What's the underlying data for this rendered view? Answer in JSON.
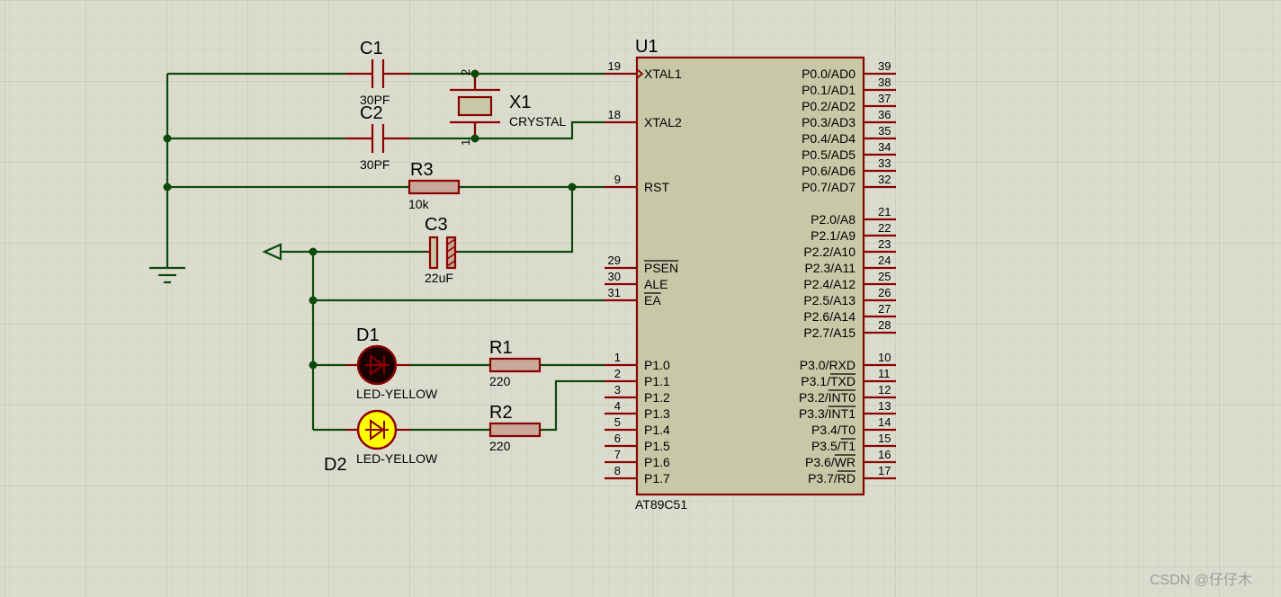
{
  "colors": {
    "background": "#dcdcce",
    "grid_minor": "#cfcfc0",
    "grid_major": "#bfbfae",
    "wire": "#0b4a0b",
    "component_outline": "#8b0000",
    "component_fill": "#c8c8a8",
    "led_d1_fill": "#1a0000",
    "led_d2_fill": "#ffff00"
  },
  "chip": {
    "ref": "U1",
    "part": "AT89C51",
    "left_pins": [
      {
        "num": "19",
        "name": "XTAL1"
      },
      {
        "num": "18",
        "name": "XTAL2"
      },
      {
        "num": "9",
        "name": "RST"
      },
      {
        "num": "29",
        "name": "PSEN"
      },
      {
        "num": "30",
        "name": "ALE"
      },
      {
        "num": "31",
        "name": "EA"
      },
      {
        "num": "1",
        "name": "P1.0"
      },
      {
        "num": "2",
        "name": "P1.1"
      },
      {
        "num": "3",
        "name": "P1.2"
      },
      {
        "num": "4",
        "name": "P1.3"
      },
      {
        "num": "5",
        "name": "P1.4"
      },
      {
        "num": "6",
        "name": "P1.5"
      },
      {
        "num": "7",
        "name": "P1.6"
      },
      {
        "num": "8",
        "name": "P1.7"
      }
    ],
    "right_pins": [
      {
        "num": "39",
        "name": "P0.0/AD0"
      },
      {
        "num": "38",
        "name": "P0.1/AD1"
      },
      {
        "num": "37",
        "name": "P0.2/AD2"
      },
      {
        "num": "36",
        "name": "P0.3/AD3"
      },
      {
        "num": "35",
        "name": "P0.4/AD4"
      },
      {
        "num": "34",
        "name": "P0.5/AD5"
      },
      {
        "num": "33",
        "name": "P0.6/AD6"
      },
      {
        "num": "32",
        "name": "P0.7/AD7"
      },
      {
        "num": "21",
        "name": "P2.0/A8"
      },
      {
        "num": "22",
        "name": "P2.1/A9"
      },
      {
        "num": "23",
        "name": "P2.2/A10"
      },
      {
        "num": "24",
        "name": "P2.3/A11"
      },
      {
        "num": "25",
        "name": "P2.4/A12"
      },
      {
        "num": "26",
        "name": "P2.5/A13"
      },
      {
        "num": "27",
        "name": "P2.6/A14"
      },
      {
        "num": "28",
        "name": "P2.7/A15"
      },
      {
        "num": "10",
        "name": "P3.0/RXD"
      },
      {
        "num": "11",
        "name": "P3.1/TXD"
      },
      {
        "num": "12",
        "name": "P3.2/INT0"
      },
      {
        "num": "13",
        "name": "P3.3/INT1"
      },
      {
        "num": "14",
        "name": "P3.4/T0"
      },
      {
        "num": "15",
        "name": "P3.5/T1"
      },
      {
        "num": "16",
        "name": "P3.6/WR"
      },
      {
        "num": "17",
        "name": "P3.7/RD"
      }
    ]
  },
  "components": {
    "c1": {
      "ref": "C1",
      "value": "30PF"
    },
    "c2": {
      "ref": "C2",
      "value": "30PF"
    },
    "x1": {
      "ref": "X1",
      "value": "CRYSTAL",
      "pin_top": "2",
      "pin_bottom": "1"
    },
    "r3": {
      "ref": "R3",
      "value": "10k"
    },
    "c3": {
      "ref": "C3",
      "value": "22uF"
    },
    "d1": {
      "ref": "D1",
      "value": "LED-YELLOW"
    },
    "d2": {
      "ref": "D2",
      "value": "LED-YELLOW"
    },
    "r1": {
      "ref": "R1",
      "value": "220"
    },
    "r2": {
      "ref": "R2",
      "value": "220"
    }
  },
  "watermark": "CSDN @仔仔木"
}
